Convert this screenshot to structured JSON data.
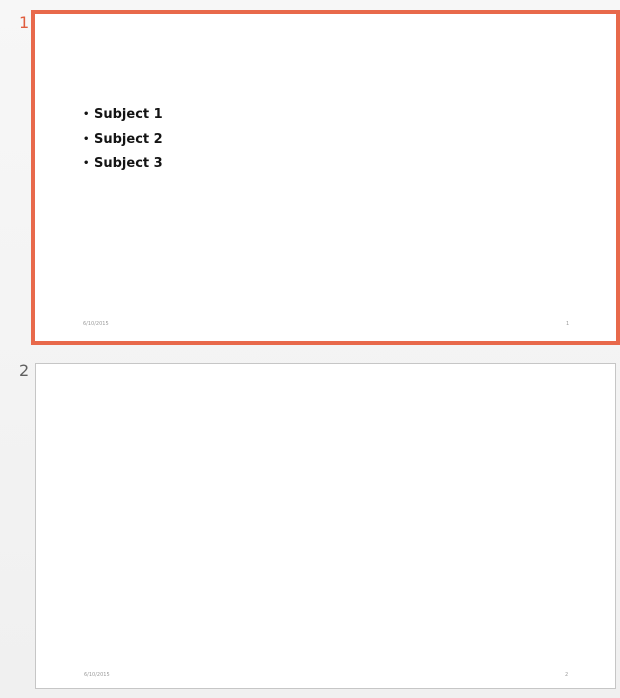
{
  "slides": [
    {
      "number": "1",
      "selected": true,
      "bullets": [
        "Subject 1",
        "Subject 2",
        "Subject 3"
      ],
      "bullet_glyph": "•",
      "footer_date": "6/10/2015",
      "footer_slide_number": "1"
    },
    {
      "number": "2",
      "selected": false,
      "bullets": [],
      "footer_date": "6/10/2015",
      "footer_slide_number": "2"
    }
  ],
  "colors": {
    "selection_border": "#e8694b",
    "selected_number": "#e05d3e",
    "thumbnail_border": "#c6c6c6",
    "pane_background": "#f3f3f3"
  }
}
